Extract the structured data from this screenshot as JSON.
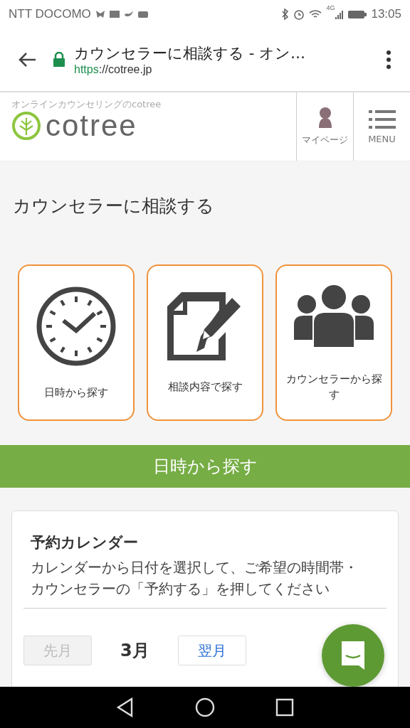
{
  "status_bar": {
    "carrier": "NTT DOCOMO",
    "network": "4G",
    "time": "13:05"
  },
  "browser": {
    "title": "カウンセラーに相談する - オン…",
    "url_scheme": "https",
    "url_rest": "://cotree.jp"
  },
  "site_header": {
    "tagline": "オンラインカウンセリングのcotree",
    "logo": "cotree",
    "mypage": "マイページ",
    "menu": "MENU"
  },
  "page_title": "カウンセラーに相談する",
  "search_options": [
    {
      "kind": "clock",
      "label": "日時から探す"
    },
    {
      "kind": "document",
      "label": "相談内容で探す"
    },
    {
      "kind": "people",
      "label": "カウンセラーから探す"
    }
  ],
  "section_bar": "日時から探す",
  "calendar": {
    "title": "予約カレンダー",
    "description": "カレンダーから日付を選択して、ご希望の時間帯・カウンセラーの「予約する」を押してください",
    "month": "3月",
    "nav_buttons": [
      {
        "label": "先月",
        "disabled": true
      },
      {
        "label": "翌月",
        "disabled": false
      }
    ]
  }
}
